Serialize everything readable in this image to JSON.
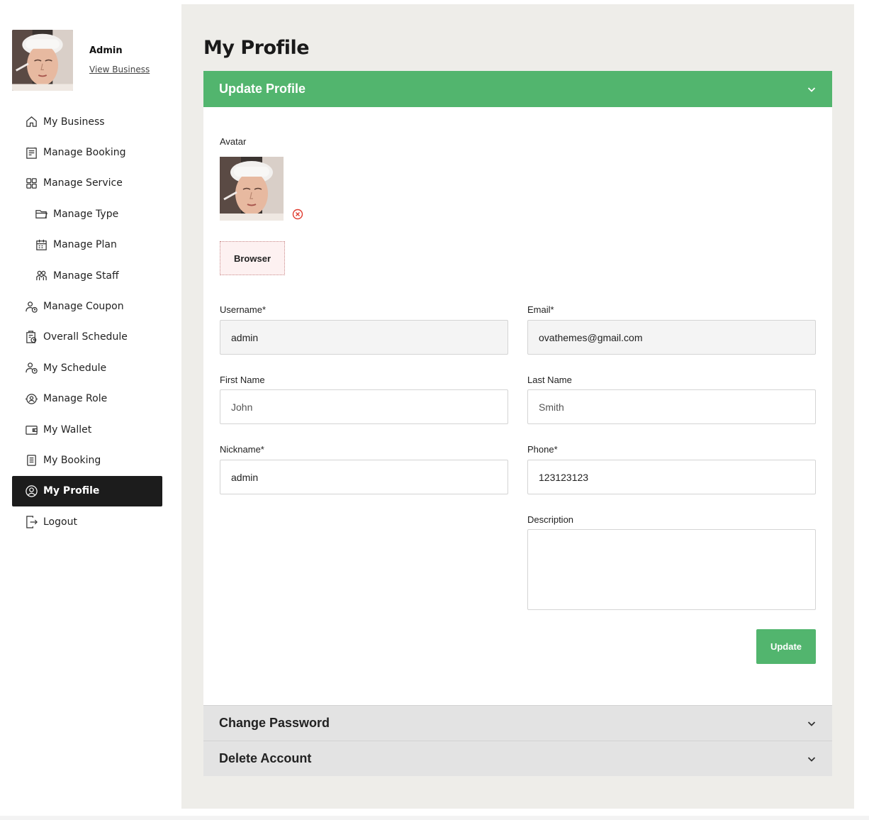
{
  "sidebar": {
    "user_name": "Admin",
    "view_business": "View Business",
    "items": [
      {
        "label": "My Business",
        "icon": "home-icon"
      },
      {
        "label": "Manage Booking",
        "icon": "checklist-icon"
      },
      {
        "label": "Manage Service",
        "icon": "grid-icon"
      },
      {
        "label": "Manage Type",
        "icon": "folder-icon"
      },
      {
        "label": "Manage Plan",
        "icon": "calendar-icon"
      },
      {
        "label": "Manage Staff",
        "icon": "staff-icon"
      },
      {
        "label": "Manage Coupon",
        "icon": "user-clock-icon"
      },
      {
        "label": "Overall Schedule",
        "icon": "clipboard-clock-icon"
      },
      {
        "label": "My Schedule",
        "icon": "user-clock-icon"
      },
      {
        "label": "Manage Role",
        "icon": "role-icon"
      },
      {
        "label": "My Wallet",
        "icon": "wallet-icon"
      },
      {
        "label": "My Booking",
        "icon": "list-icon"
      },
      {
        "label": "My Profile",
        "icon": "user-circle-icon"
      },
      {
        "label": "Logout",
        "icon": "logout-icon"
      }
    ],
    "active_item": "My Profile"
  },
  "main": {
    "page_title": "My Profile",
    "update_profile": {
      "title": "Update Profile",
      "avatar_label": "Avatar",
      "browser_button": "Browser",
      "fields": {
        "username": {
          "label": "Username*",
          "value": "admin"
        },
        "email": {
          "label": "Email*",
          "value": "ovathemes@gmail.com"
        },
        "first_name": {
          "label": "First Name",
          "placeholder": "John"
        },
        "last_name": {
          "label": "Last Name",
          "placeholder": "Smith"
        },
        "nickname": {
          "label": "Nickname*",
          "value": "admin"
        },
        "phone": {
          "label": "Phone*",
          "value": "123123123"
        },
        "description": {
          "label": "Description",
          "value": ""
        }
      },
      "update_button": "Update"
    },
    "change_password": {
      "title": "Change Password"
    },
    "delete_account": {
      "title": "Delete Account"
    }
  },
  "colors": {
    "accent_green": "#52b56e",
    "active_nav": "#1c1c1c",
    "main_bg": "#eeede9",
    "remove_red": "#e03b2f"
  }
}
